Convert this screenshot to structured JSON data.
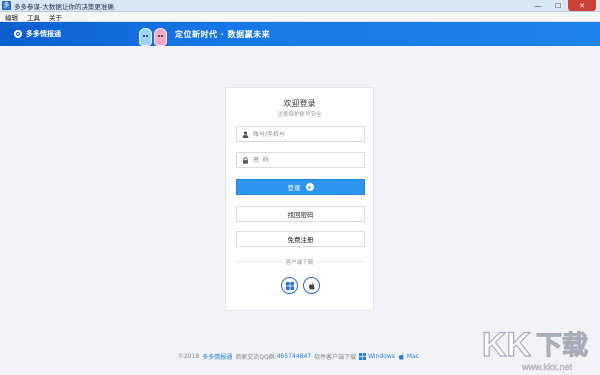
{
  "window": {
    "title": "多多参谋-大数据让你的决策更准确",
    "minimize": "—",
    "maximize": "☐",
    "close": "✕"
  },
  "menu": [
    "编辑",
    "工具",
    "关于"
  ],
  "header": {
    "logo_text": "多多情报通",
    "slogan": "定位新时代 · 数据赢未来"
  },
  "login": {
    "title": "欢迎登录",
    "subtitle": "注意保护账号安全",
    "account_placeholder": "账号/手机号",
    "password_placeholder": "密  码",
    "login_button": "登录",
    "retrieve_password_button": "找回密码",
    "register_button": "免费注册",
    "download_label": "客户端下载"
  },
  "footer": {
    "copyright": "©2018",
    "brand": "多多情报通",
    "qq_group_label": "商家交流QQ群:",
    "qq_group_number": "465744847",
    "download_label": "软件客户端下载",
    "windows_label": "Windows",
    "mac_label": "Mac"
  },
  "watermark": {
    "text": "KK下载",
    "url": "www.kkx.net"
  },
  "colors": {
    "primary": "#2c95f0",
    "banner": "#1878e8",
    "link": "#2a7de1",
    "close_button": "#c94235"
  }
}
